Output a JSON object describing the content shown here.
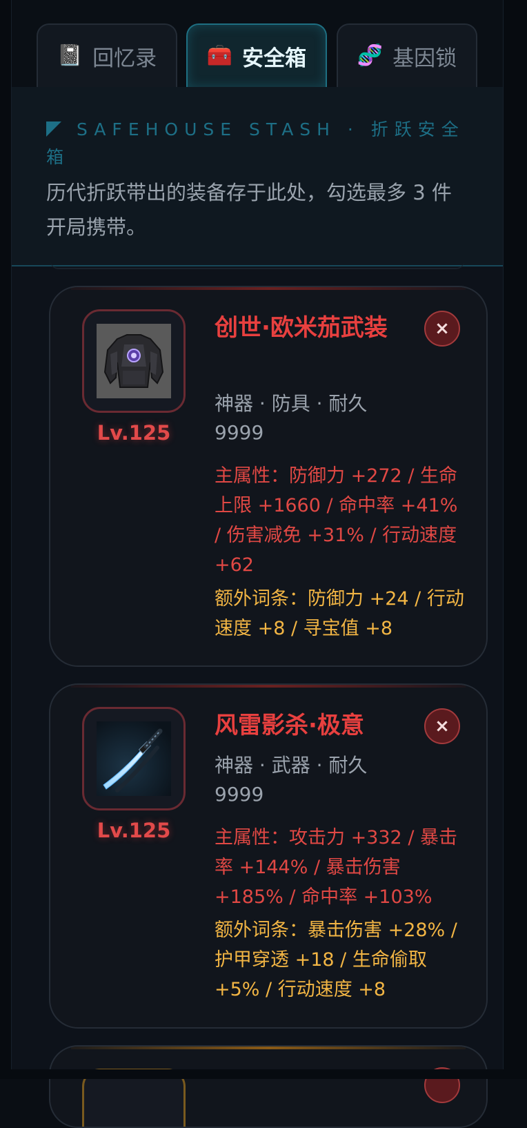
{
  "tabs": [
    {
      "icon": "📓",
      "label": "回忆录",
      "active": false
    },
    {
      "icon": "🧰",
      "label": "安全箱",
      "active": true
    },
    {
      "icon": "🧬",
      "label": "基因锁",
      "active": false
    }
  ],
  "header": {
    "eyebrow": "SAFEHOUSE STASH · 折跃安全箱",
    "description": "历代折跃带出的装备存于此处，勾选最多 3 件开局携带。"
  },
  "items": [
    {
      "name": "创世·欧米茄武装",
      "meta": "神器 · 防具 · 耐久 9999",
      "level": "Lv.125",
      "main_attr": "主属性：防御力 +272 / 生命上限 +1660 / 命中率 +41% / 伤害减免 +31% / 行动速度 +62",
      "extra_attr": "额外词条：防御力 +24 / 行动速度 +8 / 寻宝值 +8",
      "remove_label": "×",
      "icon": "armor-icon"
    },
    {
      "name": "风雷影杀·极意",
      "meta": "神器 · 武器 · 耐久 9999",
      "level": "Lv.125",
      "main_attr": "主属性：攻击力 +332 / 暴击率 +144% / 暴击伤害 +185% / 命中率 +103%",
      "extra_attr": "额外词条：暴击伤害 +28% / 护甲穿透 +18 / 生命偷取 +5% / 行动速度 +8",
      "remove_label": "×",
      "icon": "katana-icon"
    }
  ],
  "colors": {
    "accent": "#1d6f86",
    "artifact_red": "#e8403f",
    "extra_gold": "#f2b544"
  }
}
